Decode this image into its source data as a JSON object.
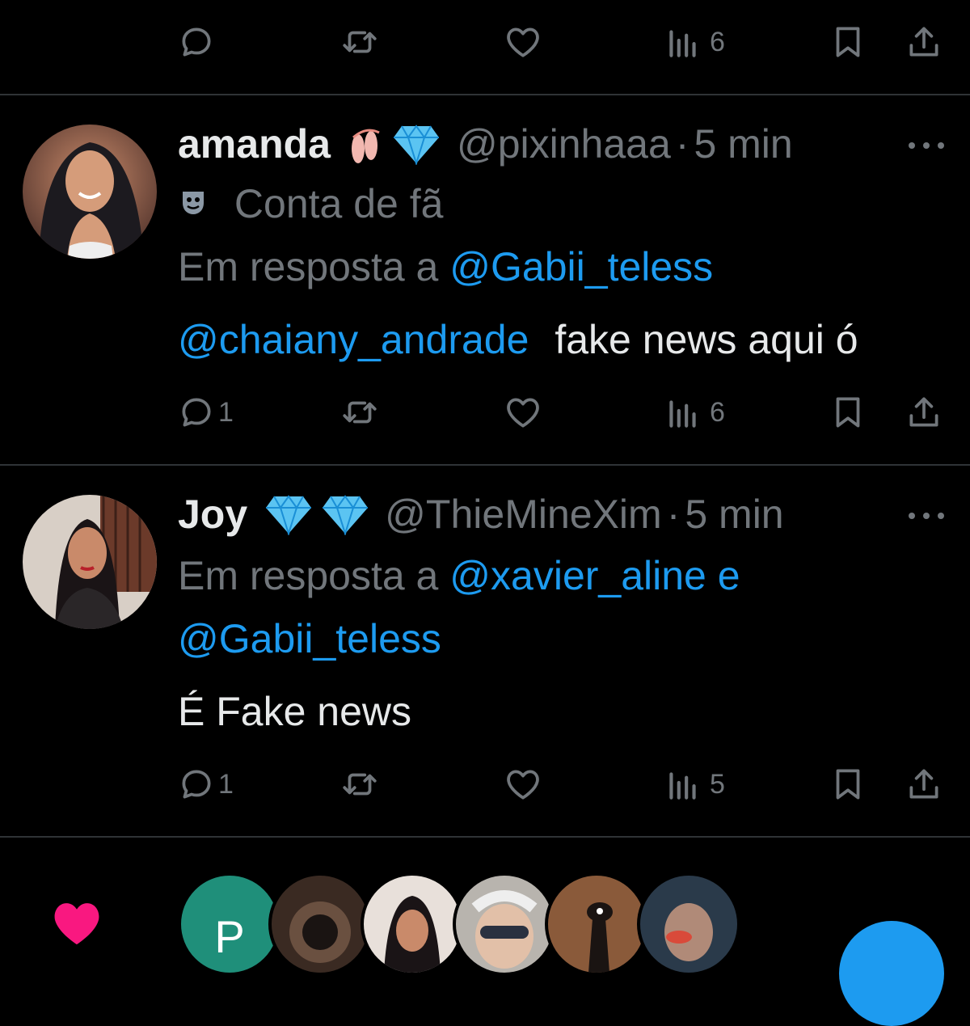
{
  "top_actions": {
    "views": "6"
  },
  "tweets": [
    {
      "display_name": "amanda",
      "handle": "@pixinhaaa",
      "dot": "·",
      "time": "5 min",
      "label": "Conta de fã",
      "reply_prefix": "Em resposta a",
      "reply_to_line1": "@Gabii_teless",
      "reply_to_line2": "",
      "mention": "@chaiany_andrade",
      "text": "fake news aqui ó",
      "replies": "1",
      "views": "6"
    },
    {
      "display_name": "Joy",
      "handle": "@ThieMineXim",
      "dot": "·",
      "time": "5 min",
      "reply_prefix": "Em resposta a",
      "reply_to_line1": "@xavier_aline e",
      "reply_to_line2": "@Gabii_teless",
      "text": "É Fake news",
      "replies": "1",
      "views": "5"
    }
  ],
  "liked_by": {
    "first_initial": "P"
  },
  "colors": {
    "accent": "#1d9bf0",
    "muted": "#71767b",
    "like": "#f91880"
  }
}
